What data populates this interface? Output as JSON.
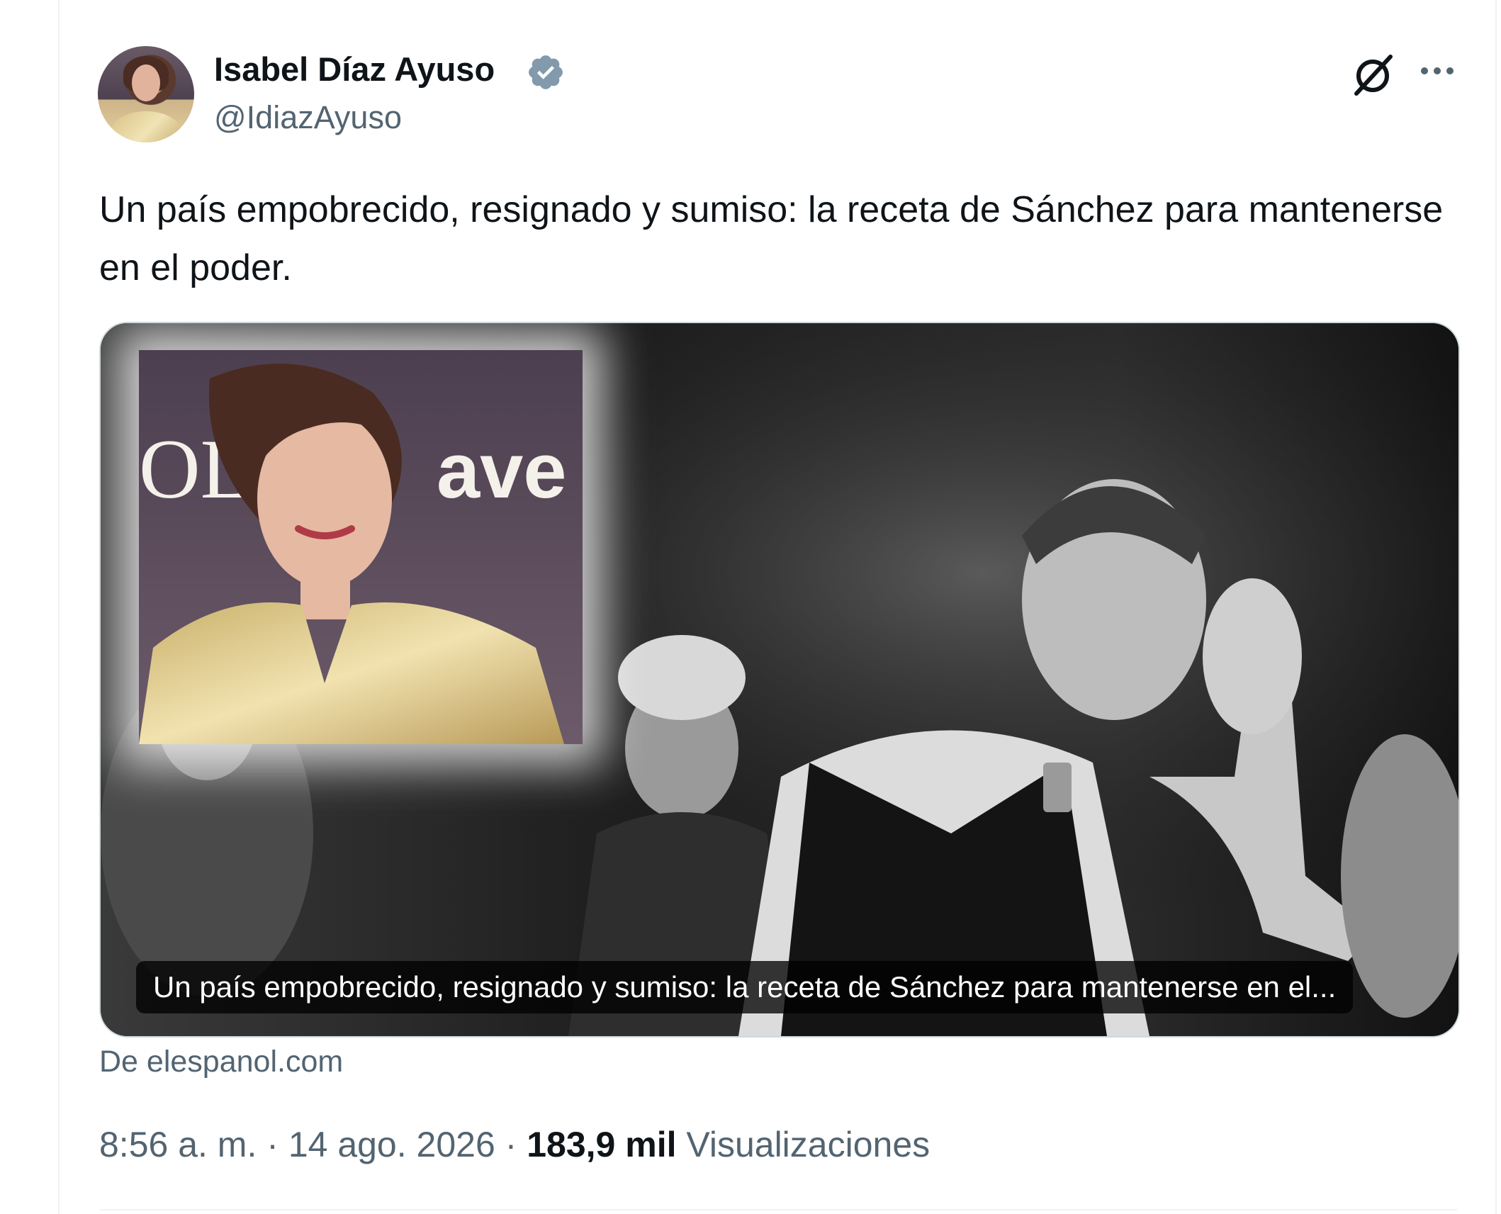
{
  "author": {
    "name": "Isabel Díaz Ayuso",
    "handle": "@IdiazAyuso"
  },
  "tweet": {
    "text": "Un país empobrecido, resignado y sumiso: la receta de Sánchez para mantenerse en el poder."
  },
  "card": {
    "caption": "Un país empobrecido, resignado y sumiso: la receta de Sánchez para mantenerse en el...",
    "inset_lettering": "OL ave",
    "source": "De elespanol.com"
  },
  "meta": {
    "time": "8:56 a. m.",
    "separator": "·",
    "date": "14 ago. 2026",
    "views_count": "183,9 mil",
    "views_label": "Visualizaciones"
  },
  "icons": {
    "verified": "verified-badge-icon",
    "grok": "grok-icon",
    "more": "more-options-icon"
  },
  "colors": {
    "text_primary": "#0f1419",
    "text_secondary": "#536471",
    "verified_badge": "#829aab",
    "divider": "#eff3f4"
  }
}
